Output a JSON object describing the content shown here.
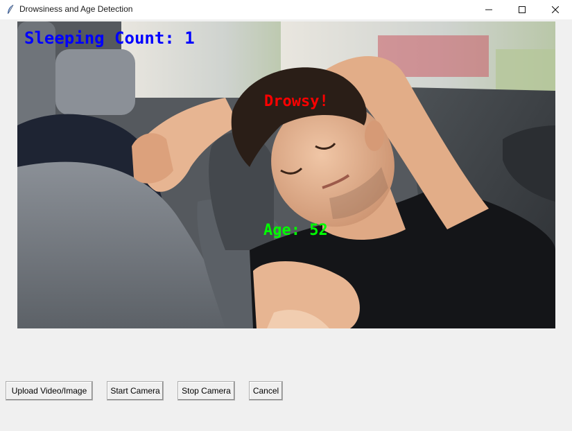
{
  "window": {
    "title": "Drowsiness and Age Detection",
    "icon": "feather-icon",
    "controls": [
      "minimize-icon",
      "maximize-icon",
      "close-icon"
    ]
  },
  "video_frame": {
    "sleeping_count_label": "Sleeping Count: 1",
    "sleeping_count_color": "#0000ff",
    "status_label": "Drowsy!",
    "status_color": "#ff0000",
    "age_label": "Age: 52",
    "age_color": "#00ff00"
  },
  "buttons": {
    "upload": "Upload Video/Image",
    "start_camera": "Start Camera",
    "stop_camera": "Stop Camera",
    "cancel": "Cancel"
  }
}
